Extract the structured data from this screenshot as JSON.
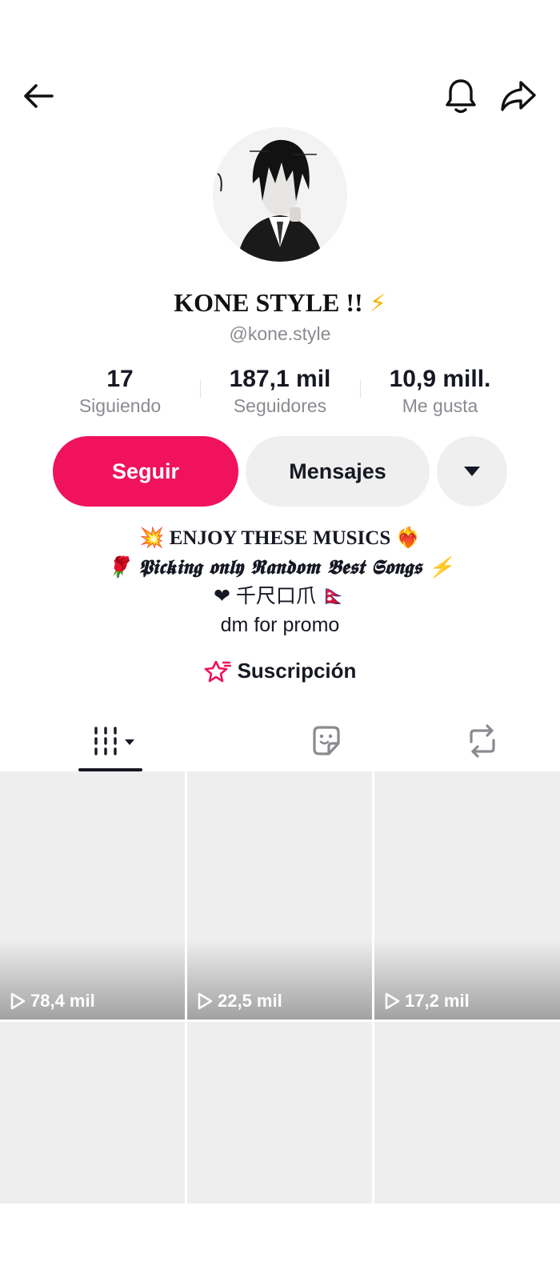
{
  "profile": {
    "display_name": "KONE STYLE !!",
    "display_name_emoji": "⚡",
    "handle": "@kone.style"
  },
  "stats": [
    {
      "value": "17",
      "label": "Siguiendo"
    },
    {
      "value": "187,1 mil",
      "label": "Seguidores"
    },
    {
      "value": "10,9 mill.",
      "label": "Me gusta"
    }
  ],
  "actions": {
    "follow_label": "Seguir",
    "message_label": "Mensajes"
  },
  "bio": {
    "line1": "💥 ENJOY THESE MUSICS ❤️‍🔥",
    "line2": "🌹 𝕻𝖎𝖈𝖐𝖎𝖓𝖌 𝖔𝖓𝖑𝖞 𝕽𝖆𝖓𝖉𝖔𝖒 𝕭𝖊𝖘𝖙 𝕾𝖔𝖓𝖌𝖘 ⚡",
    "line3": "❤ 千尺口爪 🇳🇵",
    "line4": "dm for promo"
  },
  "subscription": {
    "label": "Suscripción"
  },
  "tabs": [
    {
      "icon": "videos-grid-icon",
      "active": true
    },
    {
      "icon": "favorites-sticker-icon",
      "active": false
    },
    {
      "icon": "reposts-icon",
      "active": false
    }
  ],
  "videos": [
    {
      "views": "78,4 mil"
    },
    {
      "views": "22,5 mil"
    },
    {
      "views": "17,2 mil"
    },
    {
      "views": ""
    },
    {
      "views": ""
    },
    {
      "views": ""
    }
  ],
  "colors": {
    "accent": "#f0125d",
    "secondary_button": "#efefef",
    "muted_text": "#8a8b91",
    "primary_text": "#161823"
  }
}
